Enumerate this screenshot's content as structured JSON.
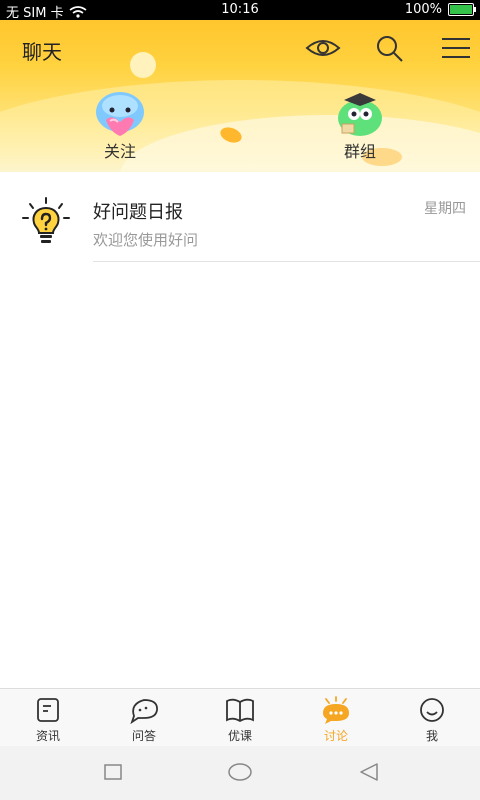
{
  "status_bar": {
    "carrier": "无 SIM 卡",
    "time": "10:16",
    "battery": "100%",
    "battery_level": 1.0
  },
  "header": {
    "title": "聊天",
    "icons": [
      "eye-icon",
      "search-icon",
      "menu-icon"
    ],
    "tiles": [
      {
        "label": "关注",
        "icon": "heart-mascot-icon"
      },
      {
        "label": "群组",
        "icon": "graduate-mascot-icon"
      }
    ]
  },
  "chats": [
    {
      "name": "好问题日报",
      "time": "星期四",
      "preview": "欢迎您使用好问",
      "icon": "lightbulb-question-icon"
    }
  ],
  "tabs": [
    {
      "label": "资讯",
      "icon": "news-icon",
      "active": false
    },
    {
      "label": "问答",
      "icon": "qa-icon",
      "active": false
    },
    {
      "label": "优课",
      "icon": "book-icon",
      "active": false
    },
    {
      "label": "讨论",
      "icon": "chat-bubble-icon",
      "active": true
    },
    {
      "label": "我",
      "icon": "smile-icon",
      "active": false
    }
  ],
  "nav_buttons": [
    "recent-apps-icon",
    "home-icon",
    "back-icon"
  ],
  "colors": {
    "accent": "#f5a623",
    "header": "#ffd23f"
  }
}
